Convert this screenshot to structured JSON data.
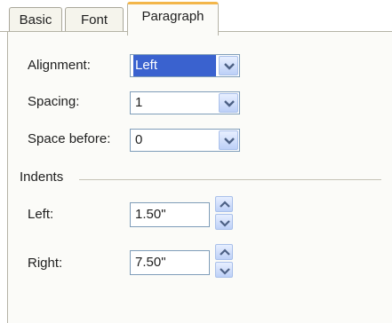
{
  "tabs": [
    "Basic",
    "Font",
    "Paragraph"
  ],
  "alignment": {
    "label": "Alignment:",
    "value": "Left"
  },
  "spacing": {
    "label": "Spacing:",
    "value": "1"
  },
  "space_before": {
    "label": "Space before:",
    "value": "0"
  },
  "indents": {
    "heading": "Indents",
    "left": {
      "label": "Left:",
      "value": "1.50\""
    },
    "right": {
      "label": "Right:",
      "value": "7.50\""
    }
  },
  "colors": {
    "accent_tab": "#f3b64a",
    "selection": "#3a62cf",
    "input_border": "#7f9db9"
  }
}
